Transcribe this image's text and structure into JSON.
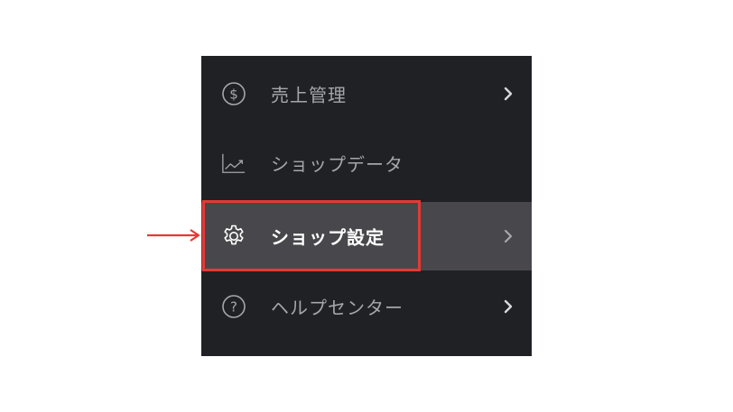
{
  "menu": {
    "items": [
      {
        "label": "売上管理",
        "icon": "dollar-circle-icon",
        "has_chevron": true
      },
      {
        "label": "ショップデータ",
        "icon": "line-chart-icon",
        "has_chevron": false
      },
      {
        "label": "ショップ設定",
        "icon": "gear-icon",
        "has_chevron": true,
        "selected": true
      },
      {
        "label": "ヘルプセンター",
        "icon": "question-circle-icon",
        "has_chevron": true
      }
    ]
  },
  "annotation": {
    "highlight_color": "#e53935",
    "arrow_color": "#e53935",
    "highlighted_item": "ショップ設定"
  },
  "colors": {
    "panel_background": "#202124",
    "selected_row_background": "#48484c",
    "text_muted": "#a6a6ab",
    "text_selected": "#ffffff"
  }
}
